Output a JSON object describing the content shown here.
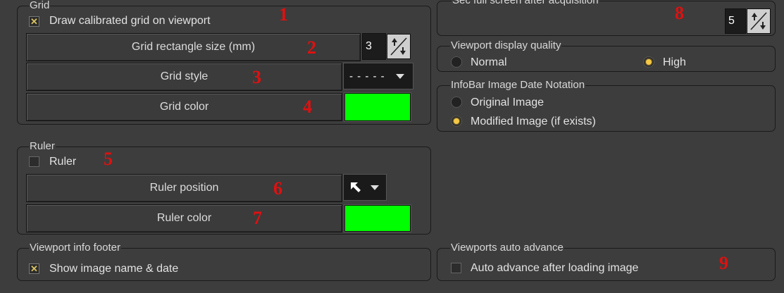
{
  "grid": {
    "legend": "Grid",
    "draw_grid_label": "Draw calibrated grid on viewport",
    "draw_grid_checked": true,
    "rect_size_label": "Grid rectangle size (mm)",
    "rect_size_value": "3",
    "style_label": "Grid style",
    "style_value": "- - - - -",
    "color_label": "Grid color",
    "color_hex": "#00ff00"
  },
  "ruler": {
    "legend": "Ruler",
    "ruler_label": "Ruler",
    "ruler_checked": false,
    "position_label": "Ruler position",
    "position_icon": "arrow-up-left-icon",
    "color_label": "Ruler color",
    "color_hex": "#00ff00"
  },
  "footer": {
    "legend": "Viewport info footer",
    "show_label": "Show image name & date",
    "show_checked": true
  },
  "fullscreen": {
    "legend": "Sec full screen after acquisition",
    "value": "5"
  },
  "quality": {
    "legend": "Viewport display quality",
    "options": [
      "Normal",
      "High"
    ],
    "selected": "High"
  },
  "infobar": {
    "legend": "InfoBar Image Date Notation",
    "options": [
      "Original Image",
      "Modified Image (if exists)"
    ],
    "selected": "Modified Image (if exists)"
  },
  "autoadvance": {
    "legend": "Viewports auto advance",
    "label": "Auto advance after loading image",
    "checked": false
  },
  "markers": [
    "1",
    "2",
    "3",
    "4",
    "5",
    "6",
    "7",
    "8",
    "9"
  ],
  "colors": {
    "accent": "#f5c845",
    "marker": "#e01010",
    "swatch": "#00ff00"
  }
}
